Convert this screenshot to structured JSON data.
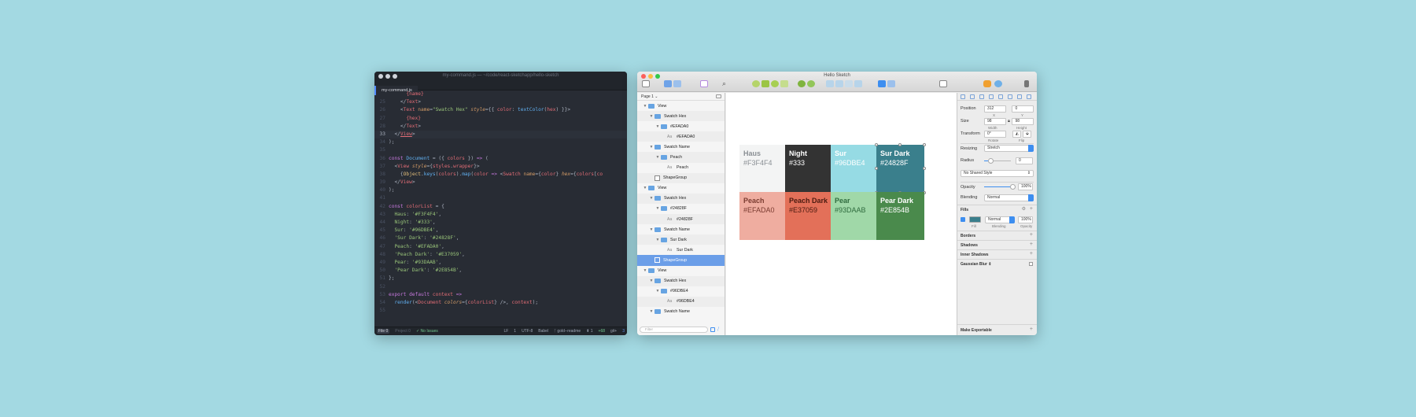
{
  "editor": {
    "title": "my-command.js — ~/code/react-sketchapp/hello-sketch",
    "tab": "my-command.js",
    "lines": [
      {
        "n": "",
        "html": "      <span style=\"color:#e06c75\">{name}</span>"
      },
      {
        "n": "25",
        "html": "    <span style=\"color:#abb2bf\">&lt;/</span><span style=\"color:#e06c75\">Text</span><span style=\"color:#abb2bf\">&gt;</span>"
      },
      {
        "n": "26",
        "html": "    <span style=\"color:#abb2bf\">&lt;</span><span style=\"color:#e06c75\">Text</span> <span style=\"color:#d19a66\">name</span>=<span style=\"color:#98c379\">\"Swatch Hex\"</span> <span style=\"color:#d19a66;font-style:italic\">style</span>={{ <span style=\"color:#e06c75\">color</span>: <span style=\"color:#61afef\">textColor</span>(<span style=\"color:#e06c75\">hex</span>) }}&gt;"
      },
      {
        "n": "27",
        "html": "      <span style=\"color:#e06c75\">{hex}</span>"
      },
      {
        "n": "28",
        "html": "    <span style=\"color:#abb2bf\">&lt;/</span><span style=\"color:#e06c75\">Text</span><span style=\"color:#abb2bf\">&gt;</span>"
      },
      {
        "n": "33",
        "html": "  <span style=\"color:#abb2bf\">&lt;/</span><span style=\"color:#e06c75;text-decoration:underline\">View</span><span style=\"color:#abb2bf\">&gt;</span>",
        "active": true
      },
      {
        "n": "34",
        "html": "<span style=\"color:#abb2bf\">);</span>"
      },
      {
        "n": "35",
        "html": ""
      },
      {
        "n": "36",
        "html": "<span style=\"color:#c678dd\">const</span> <span style=\"color:#61afef\">Document</span> = ({ <span style=\"color:#e06c75\">colors</span> }) <span style=\"color:#c678dd\">=&gt;</span> ("
      },
      {
        "n": "37",
        "html": "  &lt;<span style=\"color:#e06c75\">View</span> <span style=\"color:#d19a66;font-style:italic\">style</span>={<span style=\"color:#e06c75\">styles</span>.<span style=\"color:#e06c75\">wrapper</span>}&gt;"
      },
      {
        "n": "38",
        "html": "    {<span style=\"color:#e5c07b\">Object</span>.<span style=\"color:#61afef\">keys</span>(<span style=\"color:#e06c75\">colors</span>).<span style=\"color:#61afef\">map</span>(<span style=\"color:#e06c75\">color</span> <span style=\"color:#c678dd\">=&gt;</span> &lt;<span style=\"color:#e06c75\">Swatch</span> <span style=\"color:#d19a66\">name</span>={<span style=\"color:#e06c75\">color</span>} <span style=\"color:#d19a66;font-style:italic\">hex</span>={<span style=\"color:#e06c75\">colors</span>[<span style=\"color:#e06c75\">co</span>"
      },
      {
        "n": "39",
        "html": "  &lt;/<span style=\"color:#e06c75\">View</span>&gt;"
      },
      {
        "n": "40",
        "html": ");"
      },
      {
        "n": "41",
        "html": ""
      },
      {
        "n": "42",
        "html": "<span style=\"color:#c678dd\">const</span> <span style=\"color:#e06c75\">colorList</span> = {"
      },
      {
        "n": "43",
        "html": "  <span style=\"color:#98c379\">Haus</span>: <span style=\"color:#98c379\">'#F3F4F4'</span>,"
      },
      {
        "n": "44",
        "html": "  <span style=\"color:#98c379\">Night</span>: <span style=\"color:#98c379\">'#333'</span>,"
      },
      {
        "n": "45",
        "html": "  <span style=\"color:#98c379\">Sur</span>: <span style=\"color:#98c379\">'#96DBE4'</span>,"
      },
      {
        "n": "46",
        "html": "  <span style=\"color:#98c379\">'Sur Dark'</span>: <span style=\"color:#98c379\">'#24828F'</span>,"
      },
      {
        "n": "47",
        "html": "  <span style=\"color:#98c379\">Peach</span>: <span style=\"color:#98c379\">'#EFADA0'</span>,"
      },
      {
        "n": "48",
        "html": "  <span style=\"color:#98c379\">'Peach Dark'</span>: <span style=\"color:#98c379\">'#E37059'</span>,"
      },
      {
        "n": "49",
        "html": "  <span style=\"color:#98c379\">Pear</span>: <span style=\"color:#98c379\">'#93DAAB'</span>,"
      },
      {
        "n": "50",
        "html": "  <span style=\"color:#98c379\">'Pear Dark'</span>: <span style=\"color:#98c379\">'#2E854B'</span>,"
      },
      {
        "n": "51",
        "html": "};"
      },
      {
        "n": "52",
        "html": ""
      },
      {
        "n": "53",
        "html": "<span style=\"color:#c678dd\">export default</span> <span style=\"color:#e06c75\">context</span> <span style=\"color:#c678dd\">=&gt;</span>"
      },
      {
        "n": "54",
        "html": "  <span style=\"color:#61afef\">render</span>(&lt;<span style=\"color:#e06c75\">Document</span> <span style=\"color:#d19a66;font-style:italic\">colors</span>={<span style=\"color:#e06c75\">colorList</span>} /&gt;, <span style=\"color:#e06c75\">context</span>);"
      },
      {
        "n": "55",
        "html": ""
      }
    ],
    "status": {
      "file_chip": "File 0",
      "project_chip": "Project 0",
      "issues": "✓ No Issues",
      "line_ending": "LF",
      "cursor": "1",
      "encoding": "UTF-8",
      "grammar": "Babel",
      "branch": "gold--readme",
      "arrows": "⬆ 1",
      "diff": "+68",
      "github": "git+",
      "extra": "3"
    }
  },
  "sketch": {
    "title": "Hello Sketch",
    "page_selector": "Page 1",
    "layers": [
      {
        "depth": 0,
        "tri": "▼",
        "kind": "folder",
        "label": "View",
        "alt": false
      },
      {
        "depth": 1,
        "tri": "▼",
        "kind": "folder",
        "label": "Swatch Hex",
        "alt": true
      },
      {
        "depth": 2,
        "tri": "▼",
        "kind": "folder",
        "label": "#EFADA0",
        "alt": false
      },
      {
        "depth": 3,
        "tri": "",
        "kind": "text",
        "label": "#EFADA0",
        "alt": true
      },
      {
        "depth": 1,
        "tri": "▼",
        "kind": "folder",
        "label": "Swatch Name",
        "alt": false
      },
      {
        "depth": 2,
        "tri": "▼",
        "kind": "folder",
        "label": "Peach",
        "alt": true
      },
      {
        "depth": 3,
        "tri": "",
        "kind": "text",
        "label": "Peach",
        "alt": false
      },
      {
        "depth": 1,
        "tri": "",
        "kind": "shape",
        "label": "ShapeGroup",
        "alt": true
      },
      {
        "depth": 0,
        "tri": "▼",
        "kind": "folder",
        "label": "View",
        "alt": false
      },
      {
        "depth": 1,
        "tri": "▼",
        "kind": "folder",
        "label": "Swatch Hex",
        "alt": true
      },
      {
        "depth": 2,
        "tri": "▼",
        "kind": "folder",
        "label": "#24828F",
        "alt": false
      },
      {
        "depth": 3,
        "tri": "",
        "kind": "text",
        "label": "#24828F",
        "alt": true
      },
      {
        "depth": 1,
        "tri": "▼",
        "kind": "folder",
        "label": "Swatch Name",
        "alt": false
      },
      {
        "depth": 2,
        "tri": "▼",
        "kind": "folder",
        "label": "Sur Dark",
        "alt": true
      },
      {
        "depth": 3,
        "tri": "",
        "kind": "text",
        "label": "Sur Dark",
        "alt": false
      },
      {
        "depth": 1,
        "tri": "",
        "kind": "shape",
        "label": "ShapeGroup",
        "alt": false,
        "selected": true
      },
      {
        "depth": 0,
        "tri": "▼",
        "kind": "folder",
        "label": "View",
        "alt": false
      },
      {
        "depth": 1,
        "tri": "▼",
        "kind": "folder",
        "label": "Swatch Hex",
        "alt": true
      },
      {
        "depth": 2,
        "tri": "▼",
        "kind": "folder",
        "label": "#96DBE4",
        "alt": false
      },
      {
        "depth": 3,
        "tri": "",
        "kind": "text",
        "label": "#96DBE4",
        "alt": true
      },
      {
        "depth": 1,
        "tri": "▼",
        "kind": "folder",
        "label": "Swatch Name",
        "alt": false
      }
    ],
    "filter_placeholder": "Filter",
    "swatches": [
      {
        "name": "Haus",
        "hex": "#F3F4F4",
        "bg": "#F3F4F4",
        "fg": "#8a8f94"
      },
      {
        "name": "Night",
        "hex": "#333",
        "bg": "#333333",
        "fg": "#ffffff"
      },
      {
        "name": "Sur",
        "hex": "#96DBE4",
        "bg": "#96DBE4",
        "fg": "#ffffff"
      },
      {
        "name": "Sur Dark",
        "hex": "#24828F",
        "bg": "#3a7f8c",
        "fg": "#ffffff"
      },
      {
        "name": "Peach",
        "hex": "#EFADA0",
        "bg": "#EFADA0",
        "fg": "#7a3b30"
      },
      {
        "name": "Peach Dark",
        "hex": "#E37059",
        "bg": "#E37059",
        "fg": "#4a1a10"
      },
      {
        "name": "Pear",
        "hex": "#93DAAB",
        "bg": "#a0d8a8",
        "fg": "#2f6b3e"
      },
      {
        "name": "Pear Dark",
        "hex": "#2E854B",
        "bg": "#4a8a4c",
        "fg": "#ffffff"
      }
    ],
    "inspector": {
      "position_label": "Position",
      "pos_x": "312",
      "pos_y": "0",
      "x_label": "X",
      "y_label": "Y",
      "size_label": "Size",
      "width": "98",
      "height": "98",
      "width_label": "Width",
      "height_label": "Height",
      "transform_label": "Transform",
      "rotate": "0°",
      "rotate_label": "Rotate",
      "flip_label": "Flip",
      "resizing_label": "Resizing",
      "resizing_value": "Stretch",
      "radius_label": "Radius",
      "radius_value": "0",
      "radius_fraction": 0.2,
      "shared_style": "No Shared Style",
      "opacity_label": "Opacity",
      "opacity_value": "100%",
      "opacity_fraction": 1.0,
      "blending_label": "Blending",
      "blending_value": "Normal",
      "fills_label": "Fills",
      "fill_color": "#3a7f8c",
      "fill_blend": "Normal",
      "fill_opacity": "100%",
      "fill_sub": "Fill",
      "fill_blend_sub": "Blending",
      "fill_opacity_sub": "Opacity",
      "borders_label": "Borders",
      "shadows_label": "Shadows",
      "inner_shadows_label": "Inner Shadows",
      "gaussian_label": "Gaussian Blur ⇕",
      "exportable_label": "Make Exportable"
    }
  }
}
